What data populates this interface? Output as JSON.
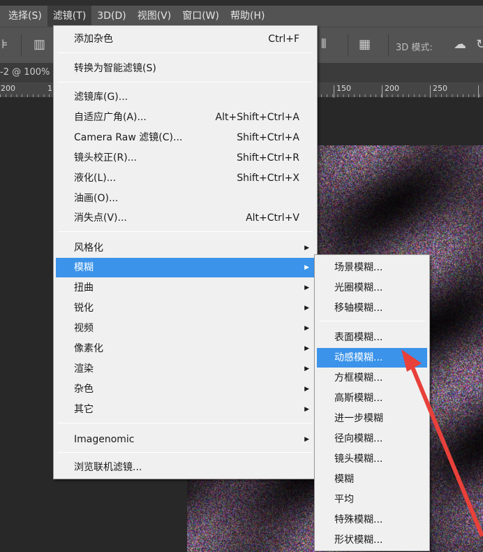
{
  "menubar": [
    "选择(S)",
    "滤镜(T)",
    "3D(D)",
    "视图(V)",
    "窗口(W)",
    "帮助(H)"
  ],
  "toolbar": {
    "mode_label": "3D 模式:"
  },
  "document": {
    "tab_title": "-2 @ 100%"
  },
  "ruler": {
    "labels": [
      "200",
      "1",
      "150",
      "200",
      "250"
    ]
  },
  "filter_menu": {
    "items": [
      {
        "label": "添加杂色",
        "shortcut": "Ctrl+F"
      },
      {
        "label": "转换为智能滤镜(S)"
      },
      {
        "label": "滤镜库(G)..."
      },
      {
        "label": "自适应广角(A)...",
        "shortcut": "Alt+Shift+Ctrl+A"
      },
      {
        "label": "Camera Raw 滤镜(C)...",
        "shortcut": "Shift+Ctrl+A"
      },
      {
        "label": "镜头校正(R)...",
        "shortcut": "Shift+Ctrl+R"
      },
      {
        "label": "液化(L)...",
        "shortcut": "Shift+Ctrl+X"
      },
      {
        "label": "油画(O)..."
      },
      {
        "label": "消失点(V)...",
        "shortcut": "Alt+Ctrl+V"
      },
      {
        "label": "风格化"
      },
      {
        "label": "模糊"
      },
      {
        "label": "扭曲"
      },
      {
        "label": "锐化"
      },
      {
        "label": "视频"
      },
      {
        "label": "像素化"
      },
      {
        "label": "渲染"
      },
      {
        "label": "杂色"
      },
      {
        "label": "其它"
      },
      {
        "label": "Imagenomic"
      },
      {
        "label": "浏览联机滤镜..."
      }
    ]
  },
  "blur_submenu": {
    "items": [
      "场景模糊...",
      "光圈模糊...",
      "移轴模糊...",
      "表面模糊...",
      "动感模糊...",
      "方框模糊...",
      "高斯模糊...",
      "进一步模糊",
      "径向模糊...",
      "镜头模糊...",
      "模糊",
      "平均",
      "特殊模糊...",
      "形状模糊..."
    ]
  },
  "colors": {
    "highlight": "#3b93ea",
    "arrow": "#e8403a"
  }
}
